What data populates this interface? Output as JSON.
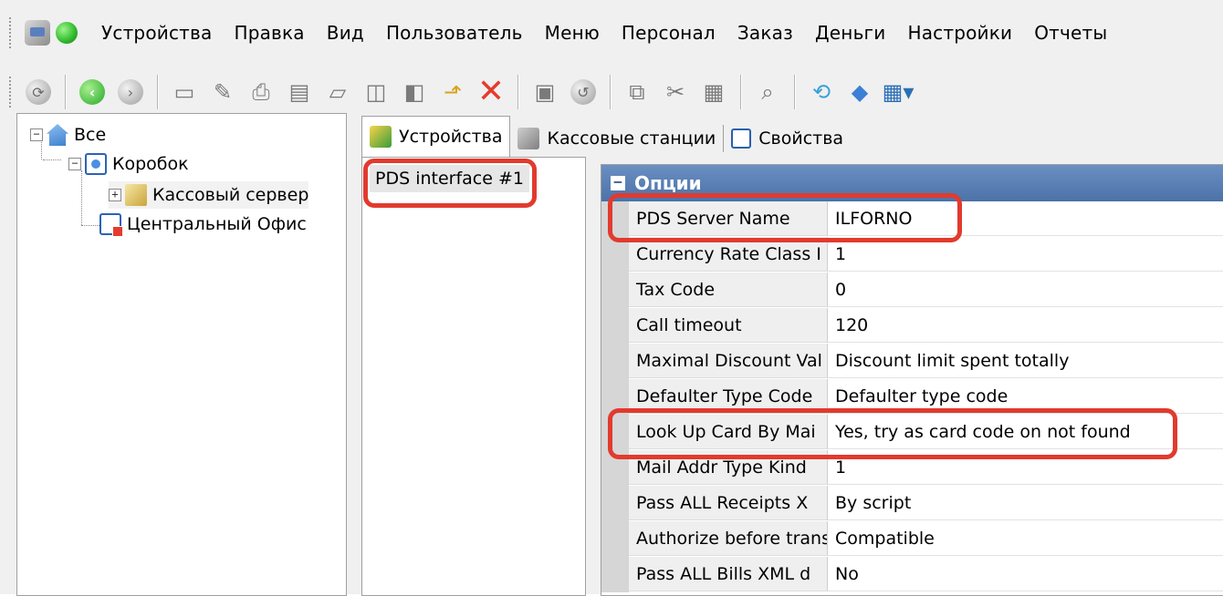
{
  "menu": {
    "items": [
      "Устройства",
      "Правка",
      "Вид",
      "Пользователь",
      "Меню",
      "Персонал",
      "Заказ",
      "Деньги",
      "Настройки",
      "Отчеты"
    ]
  },
  "toolbar": {
    "icons": [
      "refresh-icon",
      "back-icon",
      "forward-icon",
      "new-icon",
      "edit-icon",
      "print-icon",
      "preview-icon",
      "open-icon",
      "copy-doc-icon",
      "paste-doc-icon",
      "export-icon",
      "delete-icon",
      "save-icon",
      "undo-icon",
      "copy-icon",
      "cut-icon",
      "paste-icon",
      "search-icon",
      "sync-icon",
      "bookmark-icon",
      "grid-icon"
    ]
  },
  "tree": {
    "items": [
      {
        "label": "Все",
        "icon": "house-icon"
      },
      {
        "label": "Коробок",
        "icon": "box-icon"
      },
      {
        "label": "Кассовый сервер",
        "icon": "server-icon"
      },
      {
        "label": "Центральный Офис",
        "icon": "office-icon"
      }
    ]
  },
  "tabs": [
    {
      "label": "Устройства",
      "icon": "devices-icon",
      "active": true
    },
    {
      "label": "Кассовые станции",
      "icon": "cash-register-icon",
      "active": false
    },
    {
      "label": "Свойства",
      "icon": "properties-icon",
      "active": false
    }
  ],
  "devices": {
    "items": [
      "PDS interface #1"
    ]
  },
  "properties": {
    "section_title": "Опции",
    "rows": [
      {
        "name": "PDS Server Name",
        "value": "ILFORNO"
      },
      {
        "name": "Currency Rate Class I",
        "value": "1"
      },
      {
        "name": "Tax Code",
        "value": "0"
      },
      {
        "name": "Call timeout",
        "value": "120"
      },
      {
        "name": "Maximal Discount Val",
        "value": "Discount limit spent totally"
      },
      {
        "name": "Defaulter Type Code",
        "value": "Defaulter type code"
      },
      {
        "name": "Look Up Card By Mai",
        "value": "Yes, try as card code on not found"
      },
      {
        "name": "Mail Addr Type Kind",
        "value": "1"
      },
      {
        "name": "Pass ALL Receipts X",
        "value": "By script"
      },
      {
        "name": "Authorize before trans",
        "value": "Compatible"
      },
      {
        "name": "Pass ALL Bills XML d",
        "value": "No"
      }
    ]
  },
  "colors": {
    "highlight": "#e23a2e",
    "section_header": "#5a7fb5"
  }
}
